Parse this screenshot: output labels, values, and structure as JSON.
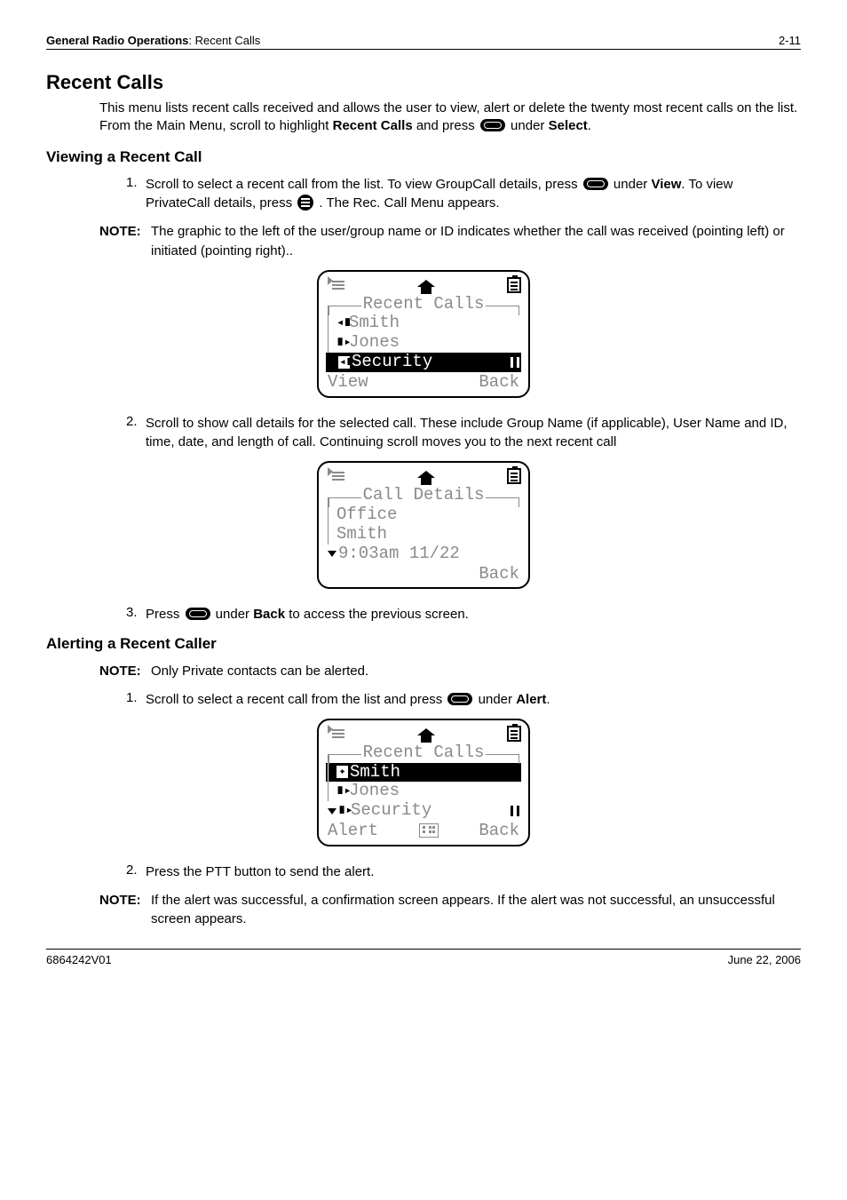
{
  "header": {
    "breadcrumb_bold": "General Radio Operations",
    "breadcrumb_rest": ": Recent Calls",
    "page_num": "2-11"
  },
  "title": "Recent Calls",
  "intro_a": "This menu lists recent calls received and allows the user to view, alert or delete the twenty most recent calls on the list. From the Main Menu, scroll to highlight ",
  "intro_b": "Recent Calls",
  "intro_c": " and press ",
  "intro_d": " under ",
  "intro_e": "Select",
  "intro_f": ".",
  "view": {
    "heading": "Viewing a Recent Call",
    "s1_a": "Scroll to select a recent call from the list. To view GroupCall details, press ",
    "s1_b": " under ",
    "s1_c": "View",
    "s1_d": ". To view PrivateCall details, press ",
    "s1_e": " . The Rec. Call Menu appears.",
    "note_a": "The graphic to the left of the user/group name or ID indicates whether the call was received (pointing left) or initiated (pointing right)..",
    "s2": "Scroll to show call details for the selected call. These include Group Name (if applicable), User Name and ID, time, date, and length of call. Continuing scroll moves you to the next recent call",
    "s3_a": "Press ",
    "s3_b": " under ",
    "s3_c": "Back",
    "s3_d": " to access the previous screen."
  },
  "alerting": {
    "heading": "Alerting a Recent Caller",
    "note": "Only Private contacts can be alerted.",
    "s1_a": "Scroll to select a recent call from the list and press ",
    "s1_b": " under ",
    "s1_c": "Alert",
    "s1_d": ".",
    "s2": "Press the PTT button to send the alert.",
    "note2": "If the alert was successful, a confirmation screen appears. If the alert was not successful, an unsuccessful screen appears."
  },
  "labels": {
    "note": "NOTE:",
    "n1": "1.",
    "n2": "2.",
    "n3": "3."
  },
  "screen1": {
    "title": "Recent Calls",
    "rows": [
      "Smith",
      "Jones",
      "Security"
    ],
    "sk_left": "View",
    "sk_right": "Back"
  },
  "screen2": {
    "title": "Call Details",
    "rows": [
      "Office",
      "Smith",
      "9:03am 11/22"
    ],
    "sk_right": "Back"
  },
  "screen3": {
    "title": "Recent Calls",
    "rows": [
      "Smith",
      "Jones",
      "Security"
    ],
    "sk_left": "Alert",
    "sk_right": "Back"
  },
  "footer": {
    "left": "6864242V01",
    "right": "June 22, 2006"
  }
}
